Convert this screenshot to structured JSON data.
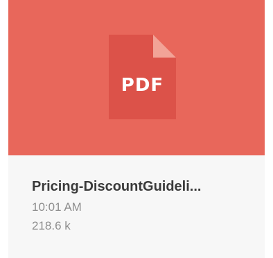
{
  "file_card": {
    "type_label": "PDF",
    "icon": "pdf-file-icon",
    "file_name": "Pricing-DiscountGuideli...",
    "time": "10:01 AM",
    "size": "218.6 k",
    "thumbnail_color": "#e8675b",
    "icon_color": "#dc5249",
    "fold_color": "#f2a397"
  }
}
